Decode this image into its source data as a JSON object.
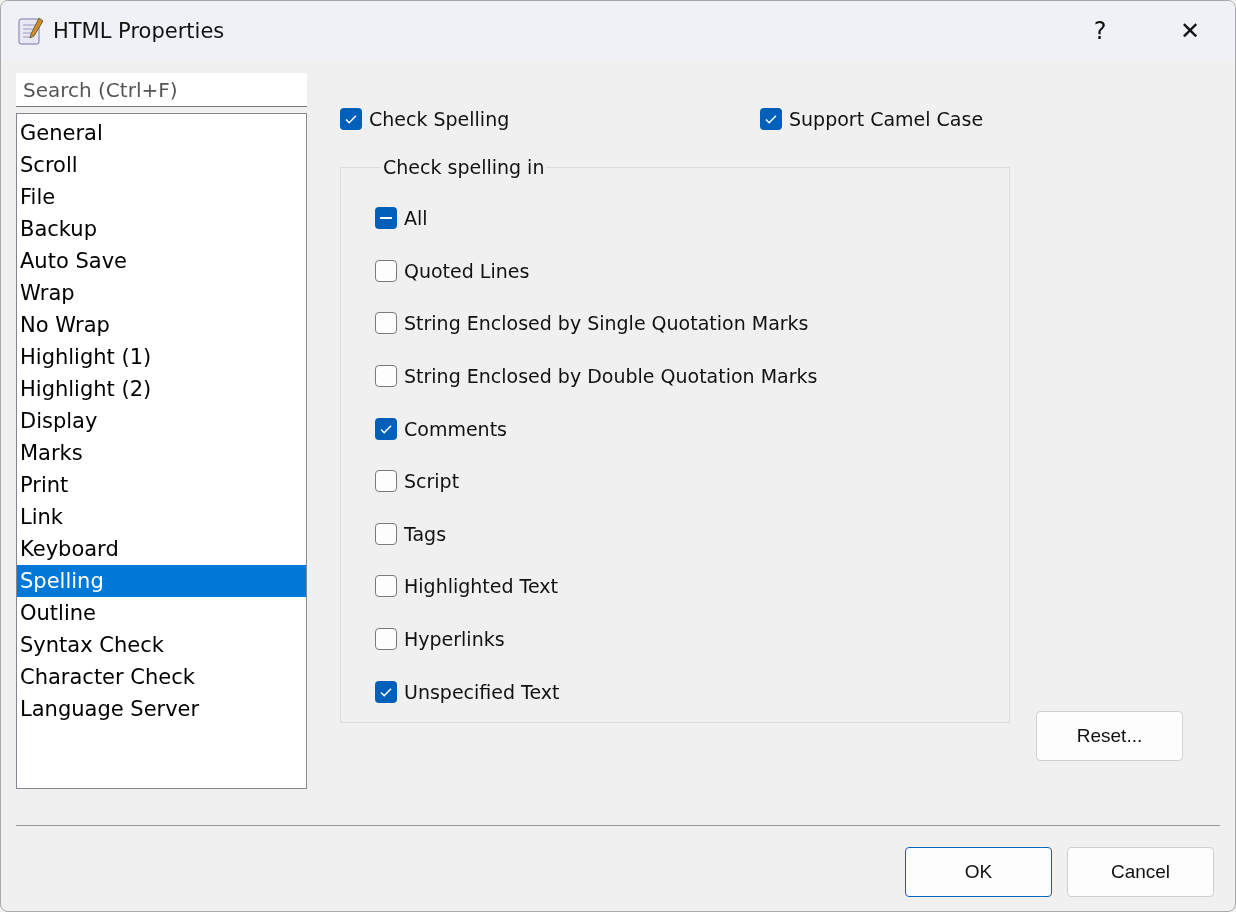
{
  "window": {
    "title": "HTML Properties",
    "help": "?",
    "close": "✕"
  },
  "search": {
    "placeholder": "Search (Ctrl+F)"
  },
  "sidebar": {
    "items": [
      {
        "label": "General",
        "selected": false
      },
      {
        "label": "Scroll",
        "selected": false
      },
      {
        "label": "File",
        "selected": false
      },
      {
        "label": "Backup",
        "selected": false
      },
      {
        "label": "Auto Save",
        "selected": false
      },
      {
        "label": "Wrap",
        "selected": false
      },
      {
        "label": "No Wrap",
        "selected": false
      },
      {
        "label": "Highlight (1)",
        "selected": false
      },
      {
        "label": "Highlight (2)",
        "selected": false
      },
      {
        "label": "Display",
        "selected": false
      },
      {
        "label": "Marks",
        "selected": false
      },
      {
        "label": "Print",
        "selected": false
      },
      {
        "label": "Link",
        "selected": false
      },
      {
        "label": "Keyboard",
        "selected": false
      },
      {
        "label": "Spelling",
        "selected": true
      },
      {
        "label": "Outline",
        "selected": false
      },
      {
        "label": "Syntax Check",
        "selected": false
      },
      {
        "label": "Character Check",
        "selected": false
      },
      {
        "label": "Language Server",
        "selected": false
      }
    ]
  },
  "options": [
    {
      "label": "Check Spelling",
      "checked": true
    },
    {
      "label": "Support Camel Case",
      "checked": true
    }
  ],
  "group": {
    "title": "Check spelling in",
    "items": [
      {
        "kind": "tristate",
        "label": "All",
        "indeterminate": true
      },
      {
        "kind": "checkbox",
        "label": "Quoted Lines",
        "checked": false
      },
      {
        "kind": "checkbox",
        "label": "String Enclosed by Single Quotation Marks",
        "checked": false
      },
      {
        "kind": "checkbox",
        "label": "String Enclosed by Double Quotation Marks",
        "checked": false
      },
      {
        "kind": "checkbox",
        "label": "Comments",
        "checked": true
      },
      {
        "kind": "checkbox",
        "label": "Script",
        "checked": false
      },
      {
        "kind": "checkbox",
        "label": "Tags",
        "checked": false
      },
      {
        "kind": "checkbox",
        "label": "Highlighted Text",
        "checked": false
      },
      {
        "kind": "checkbox",
        "label": "Hyperlinks",
        "checked": false
      },
      {
        "kind": "checkbox",
        "label": "Unspecified Text",
        "checked": true
      }
    ]
  },
  "reset_button": "Reset...",
  "buttons": [
    {
      "label": "OK",
      "default": true
    },
    {
      "label": "Cancel",
      "default": false
    }
  ]
}
